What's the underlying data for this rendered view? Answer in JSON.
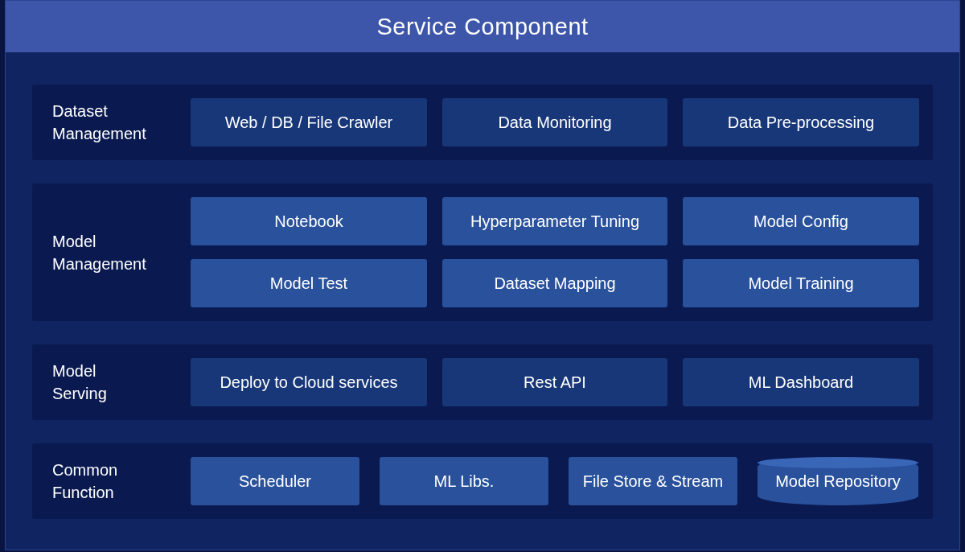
{
  "title": "Service Component",
  "sections": [
    {
      "label": [
        "Dataset",
        "Management"
      ],
      "emphasis": false,
      "rows": [
        [
          {
            "kind": "box",
            "text": "Web / DB / File Crawler"
          },
          {
            "kind": "box",
            "text": "Data Monitoring"
          },
          {
            "kind": "box",
            "text": "Data Pre-processing"
          }
        ]
      ]
    },
    {
      "label": [
        "Model",
        "Management"
      ],
      "emphasis": true,
      "rows": [
        [
          {
            "kind": "box",
            "text": "Notebook"
          },
          {
            "kind": "box",
            "text": "Hyperparameter Tuning"
          },
          {
            "kind": "box",
            "text": "Model Config"
          }
        ],
        [
          {
            "kind": "box",
            "text": "Model Test"
          },
          {
            "kind": "box",
            "text": "Dataset Mapping"
          },
          {
            "kind": "box",
            "text": "Model Training"
          }
        ]
      ]
    },
    {
      "label": [
        "Model",
        "Serving"
      ],
      "emphasis": false,
      "rows": [
        [
          {
            "kind": "box",
            "text": "Deploy to Cloud services"
          },
          {
            "kind": "box",
            "text": "Rest API"
          },
          {
            "kind": "box",
            "text": "ML Dashboard"
          }
        ]
      ]
    },
    {
      "label": [
        "Common",
        "Function"
      ],
      "emphasis": true,
      "rows": [
        [
          {
            "kind": "box",
            "text": "Scheduler"
          },
          {
            "kind": "box",
            "text": "ML Libs."
          },
          {
            "kind": "box",
            "text": "File Store & Stream"
          },
          {
            "kind": "cylinder",
            "text": "Model Repository"
          }
        ]
      ]
    }
  ]
}
